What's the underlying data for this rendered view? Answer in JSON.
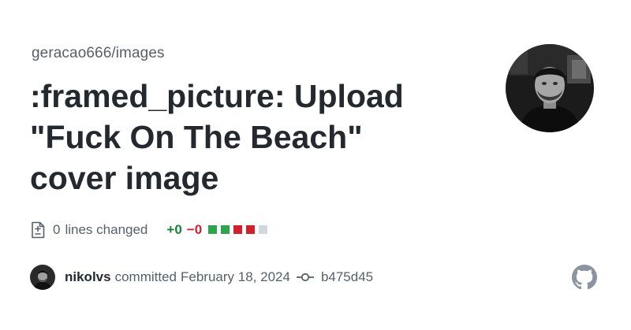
{
  "repo": {
    "owner_repo": "geracao666/images"
  },
  "commit": {
    "title_lines": [
      ":framed_picture: Upload",
      "\"Fuck On The Beach\"",
      "cover image"
    ],
    "author": "nikolvs",
    "verb": "committed",
    "date": "February 18, 2024",
    "sha": "b475d45"
  },
  "stats": {
    "lines_count": "0",
    "lines_label": "lines changed",
    "additions": "+0",
    "deletions": "−0",
    "diff_boxes": [
      "#2da44e",
      "#2da44e",
      "#cf222e",
      "#cf222e",
      "#d0d7de"
    ]
  },
  "icons": {
    "diff": "file-diff-icon",
    "commit": "git-commit-icon",
    "brand": "github-mark-icon"
  },
  "colors": {
    "additions": "#1a7f37",
    "deletions": "#cf222e",
    "muted": "#57606a",
    "text": "#24292f"
  }
}
